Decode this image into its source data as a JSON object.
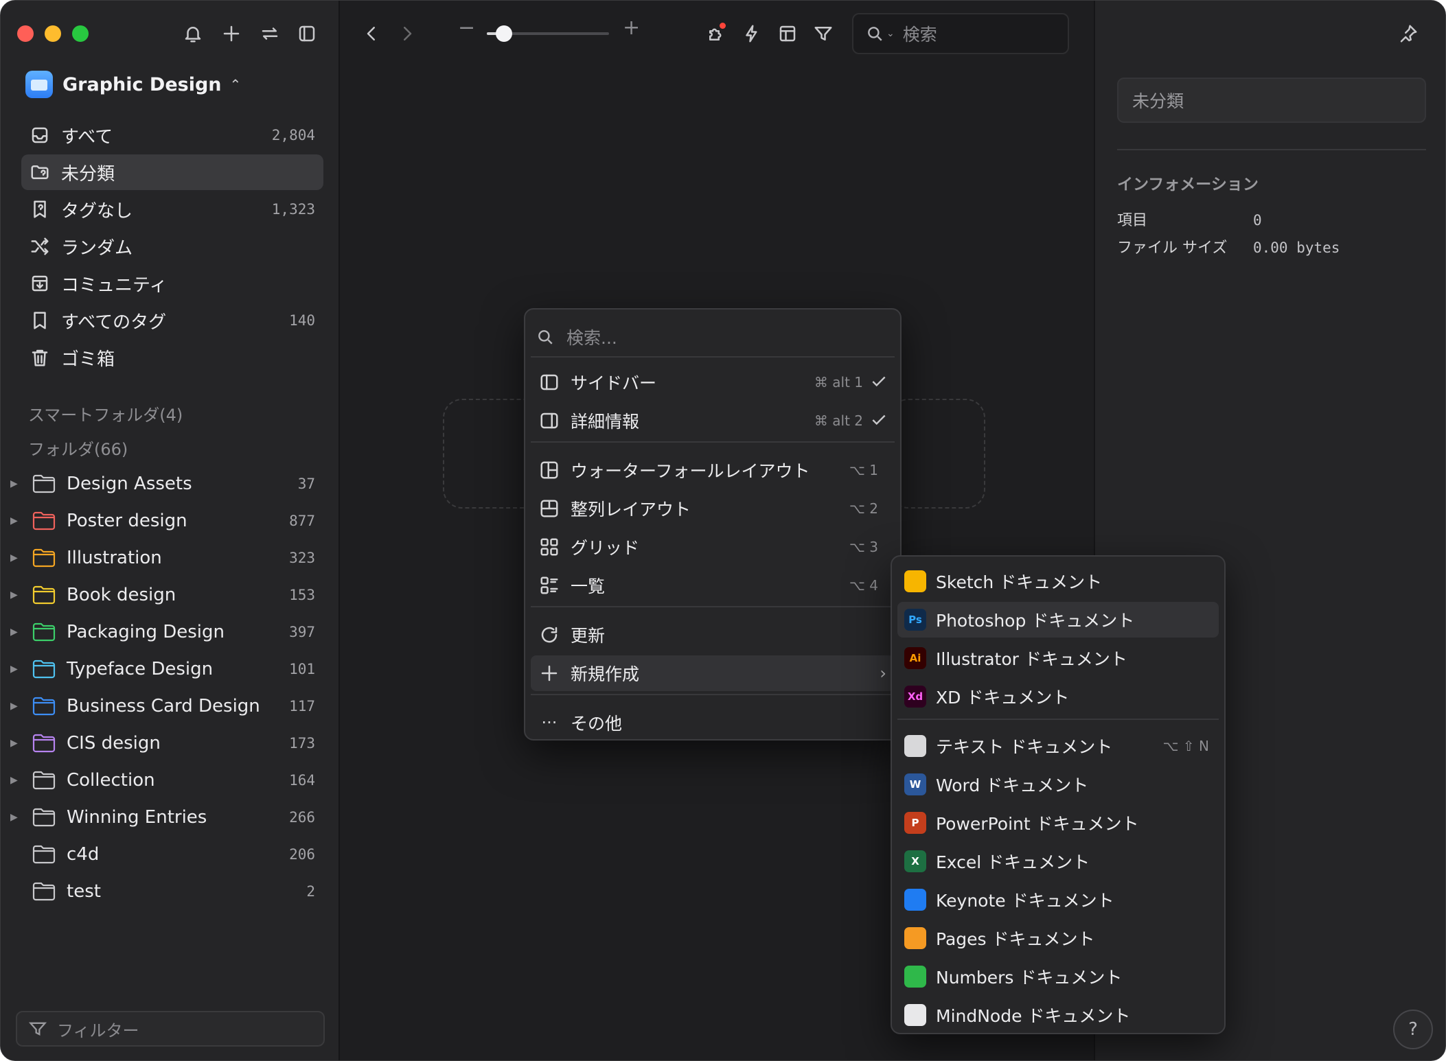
{
  "toolbar": {
    "search_placeholder": "検索",
    "zoom_minus": "−",
    "zoom_plus": "+",
    "zoom_level": 0.14
  },
  "library": {
    "title": "Graphic Design"
  },
  "nav": [
    {
      "label": "すべて",
      "count": "2,804",
      "icon": "inbox-icon"
    },
    {
      "label": "未分類",
      "count": "",
      "icon": "unfiled-folder-icon"
    },
    {
      "label": "タグなし",
      "count": "1,323",
      "icon": "untagged-icon"
    },
    {
      "label": "ランダム",
      "count": "",
      "icon": "shuffle-icon"
    },
    {
      "label": "コミュニティ",
      "count": "",
      "icon": "download-box-icon"
    },
    {
      "label": "すべてのタグ",
      "count": "140",
      "icon": "bookmark-icon"
    },
    {
      "label": "ゴミ箱",
      "count": "",
      "icon": "trash-icon"
    }
  ],
  "sections": {
    "smart_folders": "スマートフォルダ(4)",
    "folders": "フォルダ(66)"
  },
  "folders": [
    {
      "name": "Design Assets",
      "count": "37",
      "color": "#c9c9cc",
      "arrow": true
    },
    {
      "name": "Poster design",
      "count": "877",
      "color": "#f0625c",
      "arrow": true
    },
    {
      "name": "Illustration",
      "count": "323",
      "color": "#f5a623",
      "arrow": true
    },
    {
      "name": "Book design",
      "count": "153",
      "color": "#f2cc2e",
      "arrow": true
    },
    {
      "name": "Packaging Design",
      "count": "397",
      "color": "#3ccf6a",
      "arrow": true
    },
    {
      "name": "Typeface Design",
      "count": "101",
      "color": "#4fc2f0",
      "arrow": true
    },
    {
      "name": "Business Card Design",
      "count": "117",
      "color": "#3d8ef5",
      "arrow": true
    },
    {
      "name": "CIS design",
      "count": "173",
      "color": "#b784f0",
      "arrow": true
    },
    {
      "name": "Collection",
      "count": "164",
      "color": "#c9c9cc",
      "arrow": true
    },
    {
      "name": "Winning Entries",
      "count": "266",
      "color": "#c9c9cc",
      "arrow": true
    },
    {
      "name": "c4d",
      "count": "206",
      "color": "#c9c9cc",
      "arrow": false
    },
    {
      "name": "test",
      "count": "2",
      "color": "#c9c9cc",
      "arrow": false
    }
  ],
  "filter_placeholder": "フィルター",
  "context_menu": {
    "search_placeholder": "検索...",
    "items": [
      {
        "label": "サイドバー",
        "shortcut": "⌘ alt 1",
        "checked": true,
        "icon": "sidebar-icon"
      },
      {
        "label": "詳細情報",
        "shortcut": "⌘ alt 2",
        "checked": true,
        "icon": "inspector-icon"
      },
      {
        "label": "ウォーターフォールレイアウト",
        "shortcut": "⌥ 1",
        "checked": false,
        "icon": "waterfall-layout-icon"
      },
      {
        "label": "整列レイアウト",
        "shortcut": "⌥ 2",
        "checked": false,
        "icon": "justified-layout-icon"
      },
      {
        "label": "グリッド",
        "shortcut": "⌥ 3",
        "checked": false,
        "icon": "grid-icon"
      },
      {
        "label": "一覧",
        "shortcut": "⌥ 4",
        "checked": false,
        "icon": "list-icon"
      },
      {
        "label": "更新",
        "shortcut": "",
        "checked": false,
        "icon": "refresh-icon"
      },
      {
        "label": "新規作成",
        "shortcut": "",
        "checked": false,
        "icon": "plus-icon"
      },
      {
        "label": "その他",
        "shortcut": "",
        "checked": false,
        "icon": "more-icon"
      }
    ]
  },
  "submenu": {
    "items": [
      {
        "label": "Sketch ドキュメント",
        "badge": "",
        "color": "#f7b500",
        "icon": "sketch-app-icon"
      },
      {
        "label": "Photoshop ドキュメント",
        "badge": "Ps",
        "color": "#0f2a4a",
        "fg": "#31a8ff",
        "icon": "photoshop-app-icon"
      },
      {
        "label": "Illustrator ドキュメント",
        "badge": "Ai",
        "color": "#330000",
        "fg": "#ff9a00",
        "icon": "illustrator-app-icon"
      },
      {
        "label": "XD ドキュメント",
        "badge": "Xd",
        "color": "#2e001f",
        "fg": "#ff61f6",
        "icon": "xd-app-icon"
      },
      {
        "label": "テキスト ドキュメント",
        "badge": "",
        "shortcut": "⌥ ⇧ N",
        "color": "#d8d8da",
        "icon": "text-document-icon"
      },
      {
        "label": "Word ドキュメント",
        "badge": "W",
        "color": "#2b579a",
        "fg": "#ffffff",
        "icon": "word-app-icon"
      },
      {
        "label": "PowerPoint ドキュメント",
        "badge": "P",
        "color": "#c43e1c",
        "fg": "#ffffff",
        "icon": "powerpoint-app-icon"
      },
      {
        "label": "Excel ドキュメント",
        "badge": "X",
        "color": "#1d6f42",
        "fg": "#ffffff",
        "icon": "excel-app-icon"
      },
      {
        "label": "Keynote ドキュメント",
        "badge": "",
        "color": "#1f7cf2",
        "icon": "keynote-app-icon"
      },
      {
        "label": "Pages ドキュメント",
        "badge": "",
        "color": "#f59a23",
        "icon": "pages-app-icon"
      },
      {
        "label": "Numbers ドキュメント",
        "badge": "",
        "color": "#2fb84a",
        "icon": "numbers-app-icon"
      },
      {
        "label": "MindNode ドキュメント",
        "badge": "",
        "color": "#e8e8ea",
        "icon": "mindnode-app-icon"
      }
    ]
  },
  "inspector": {
    "name_placeholder": "未分類",
    "section": "インフォメーション",
    "rows": [
      {
        "key": "項目",
        "value": "0"
      },
      {
        "key": "ファイル サイズ",
        "value": "0.00 bytes"
      }
    ]
  },
  "help": "?"
}
